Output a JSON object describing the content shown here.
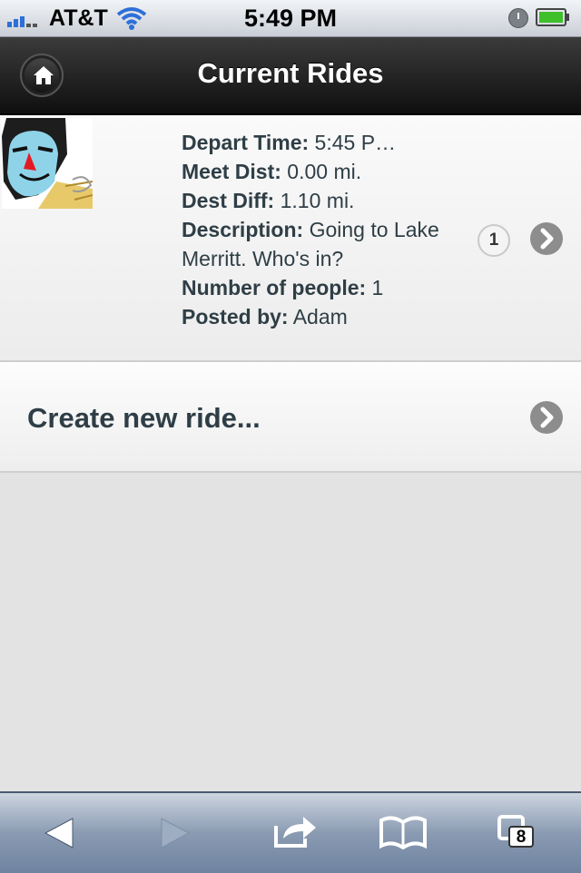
{
  "status_bar": {
    "carrier": "AT&T",
    "time": "5:49 PM"
  },
  "header": {
    "title": "Current Rides"
  },
  "ride": {
    "depart_label": "Depart Time:",
    "depart_value": " 5:45 P…",
    "meet_label": "Meet Dist:",
    "meet_value": " 0.00 mi.",
    "dest_label": "Dest Diff:",
    "dest_value": " 1.10 mi.",
    "description_label": "Description:",
    "description_value": " Going to Lake Merritt. Who's in?",
    "people_label": "Number of people:",
    "people_value": " 1",
    "posted_label": "Posted by:",
    "posted_value": " Adam",
    "count": "1"
  },
  "create": {
    "label": "Create new ride..."
  },
  "toolbar": {
    "tabs_count": "8"
  },
  "colors": {
    "header_bg": "#1a1a1a",
    "text": "#2f3e46",
    "toolbar": "#8a9bb2"
  }
}
